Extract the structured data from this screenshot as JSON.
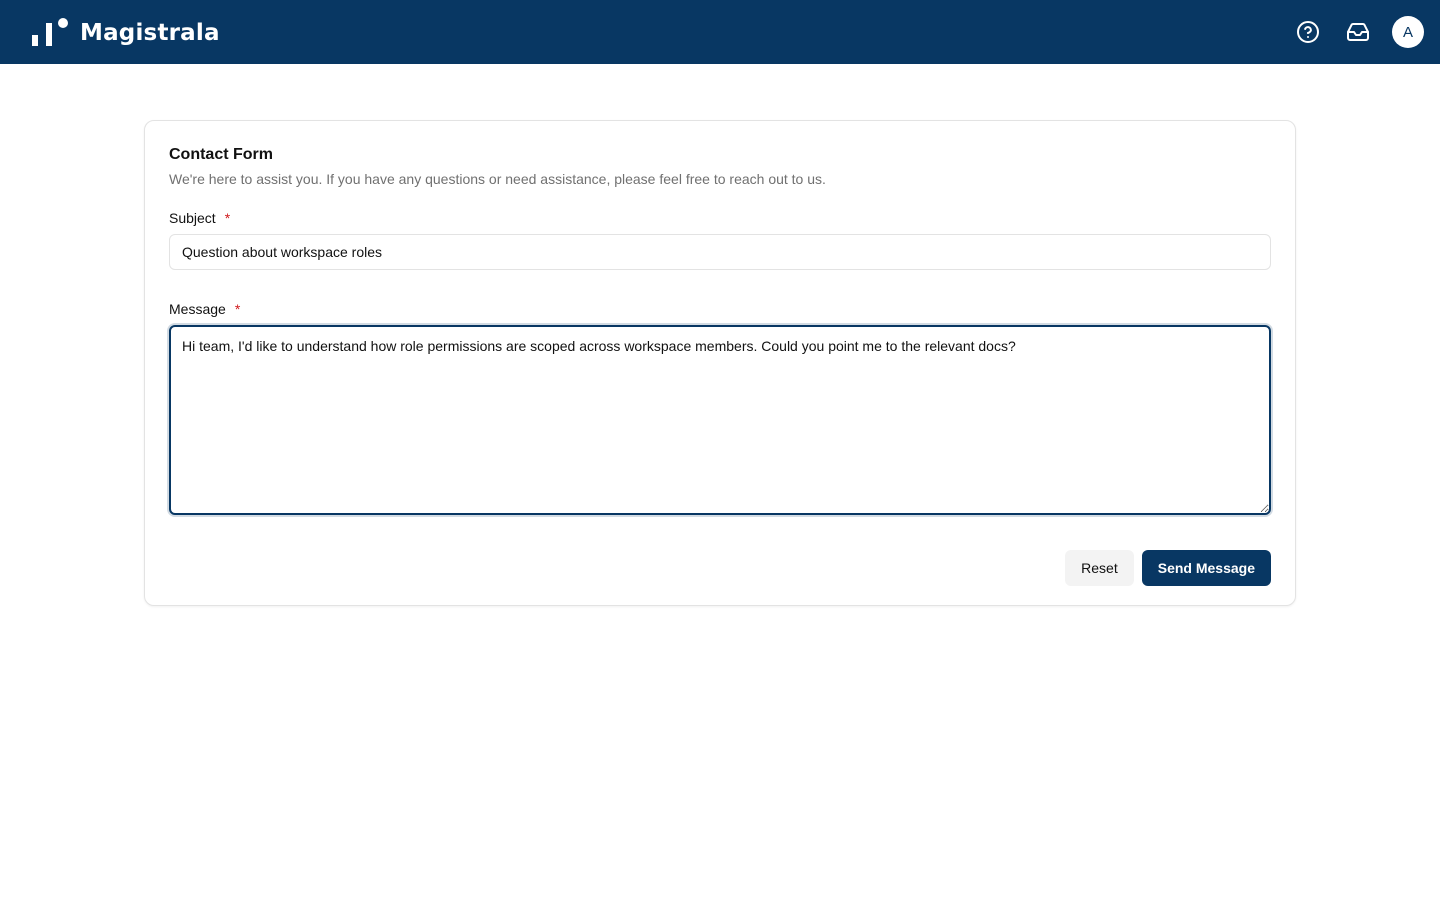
{
  "app": {
    "name": "Magistrala",
    "colors": {
      "brand": "#083763",
      "required": "#d0191d",
      "muted_text": "#707070"
    }
  },
  "header": {
    "icons": [
      "help-circle-icon",
      "inbox-icon"
    ],
    "avatar_initial": "A"
  },
  "form": {
    "title": "Contact Form",
    "description": "We're here to assist you. If you have any questions or need assistance, please feel free to reach out to us.",
    "subject": {
      "label": "Subject",
      "required_marker": "*",
      "value": "Question about workspace roles"
    },
    "message": {
      "label": "Message",
      "required_marker": "*",
      "value": "Hi team, I'd like to understand how role permissions are scoped across workspace members. Could you point me to the relevant docs?"
    },
    "buttons": {
      "reset": "Reset",
      "submit": "Send Message"
    }
  }
}
